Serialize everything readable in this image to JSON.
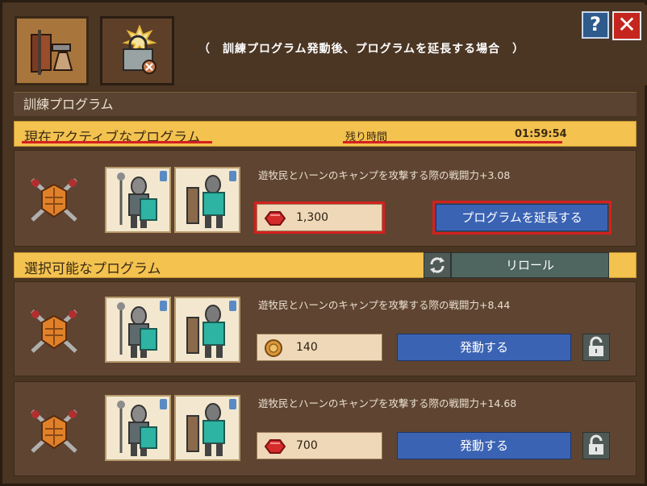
{
  "title": "（　訓練プログラム発動後、プログラムを延長する場合　）",
  "help_label": "?",
  "close_label": "✕",
  "tabs": [
    {
      "name": "training-tab",
      "icon": "signpost-icon"
    },
    {
      "name": "special-tab",
      "icon": "lock-burst-icon"
    }
  ],
  "training_section": {
    "label": "訓練プログラム"
  },
  "active": {
    "label": "現在アクティブなプログラム",
    "remaining_label": "残り時間",
    "remaining_value": "01:59:54",
    "description": "遊牧民とハーンのキャンプを攻撃する際の戦闘力+3.08",
    "cost_value": "1,300",
    "cost_icon": "ruby-icon",
    "extend_label": "プログラムを延長する"
  },
  "available": {
    "label": "選択可能なプログラム",
    "reroll_label": "リロール",
    "programs": [
      {
        "description": "遊牧民とハーンのキャンプを攻撃する際の戦闘力+8.44",
        "cost_value": "140",
        "cost_icon": "coin-icon",
        "action_label": "発動する"
      },
      {
        "description": "遊牧民とハーンのキャンプを攻撃する際の戦闘力+14.68",
        "cost_value": "700",
        "cost_icon": "ruby-icon",
        "action_label": "発動する"
      }
    ]
  },
  "colors": {
    "accent_yellow": "#f3c24f",
    "button_blue": "#3b63b3",
    "highlight_red": "#d42020"
  }
}
